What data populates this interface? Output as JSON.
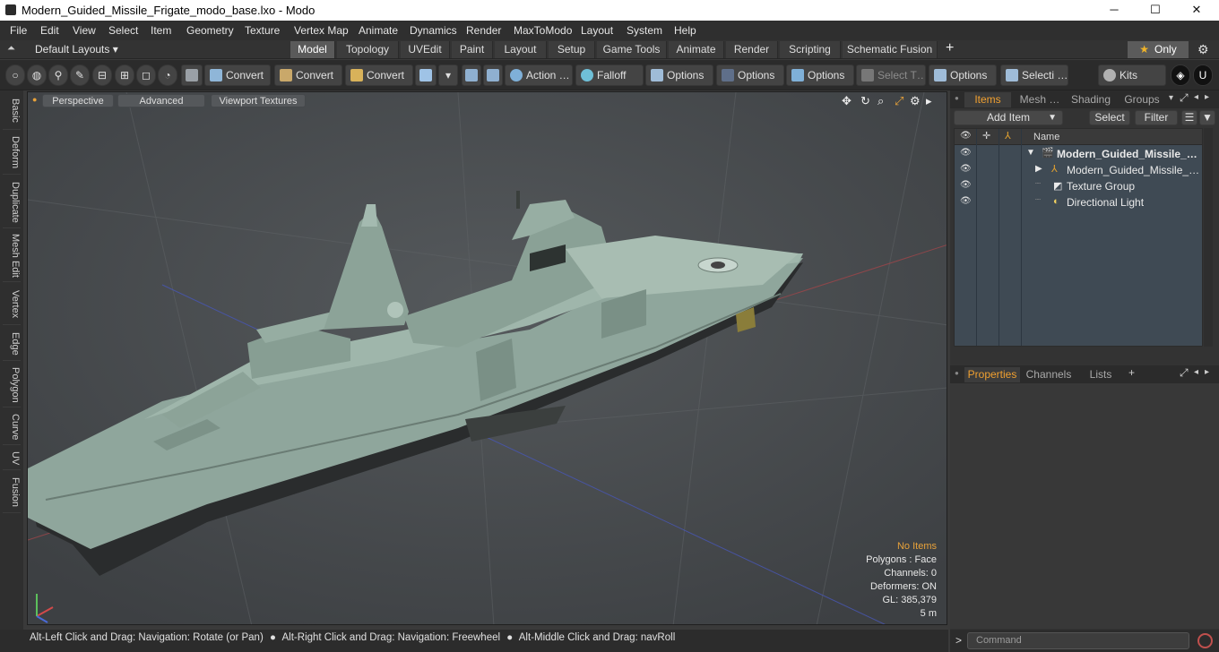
{
  "window": {
    "title": "Modern_Guided_Missile_Frigate_modo_base.lxo - Modo",
    "minimize": "─",
    "maximize": "☐",
    "close": "✕"
  },
  "menu": [
    "File",
    "Edit",
    "View",
    "Select",
    "Item",
    "Geometry",
    "Texture",
    "Vertex Map",
    "Animate",
    "Dynamics",
    "Render",
    "MaxToModo",
    "Layout",
    "System",
    "Help"
  ],
  "layout_bar": {
    "layouts_label": "Default Layouts ▾",
    "tabs": [
      "Model",
      "Topology",
      "UVEdit",
      "Paint",
      "Layout",
      "Setup",
      "Game Tools",
      "Animate",
      "Render",
      "Scripting",
      "Schematic Fusion"
    ],
    "active_tab": "Model",
    "plus": "+",
    "only_label": "Only",
    "star": "★",
    "gear": "⚙"
  },
  "toolbar": {
    "convert_1": "Convert",
    "convert_2": "Convert",
    "convert_3": "Convert",
    "action": "Action …",
    "falloff": "Falloff",
    "options_1": "Options",
    "options_2": "Options",
    "options_3": "Options",
    "select_t": "Select T…",
    "options_4": "Options",
    "selecti": "Selecti …",
    "kits": "Kits"
  },
  "left_tabs": [
    "Basic",
    "Deform",
    "Duplicate",
    "Mesh Edit",
    "Vertex",
    "Edge",
    "Polygon",
    "Curve",
    "UV",
    "Fusion"
  ],
  "viewport": {
    "perspective": "Perspective",
    "advanced": "Advanced",
    "viewport_textures": "Viewport Textures",
    "info": {
      "no_items": "No Items",
      "polygons": "Polygons : Face",
      "channels": "Channels: 0",
      "deformers": "Deformers: ON",
      "gl": "GL: 385,379",
      "scale": "5 m"
    }
  },
  "status": {
    "part1": "Alt-Left Click and Drag: Navigation: Rotate (or Pan)",
    "part2": "Alt-Right Click and Drag: Navigation: Freewheel",
    "part3": "Alt-Middle Click and Drag: navRoll",
    "dot": "●"
  },
  "items_panel": {
    "tabs": [
      "Items",
      "Mesh …",
      "Shading",
      "Groups"
    ],
    "active_tab": "Items",
    "add_item": "Add Item",
    "select": "Select",
    "filter": "Filter",
    "name_header": "Name",
    "rows": [
      {
        "label": "Modern_Guided_Missile_F…",
        "bold": true
      },
      {
        "label": "Modern_Guided_Missile_Frig…",
        "bold": false
      },
      {
        "label": "Texture Group",
        "bold": false
      },
      {
        "label": "Directional Light",
        "bold": false
      }
    ]
  },
  "properties_panel": {
    "tabs": [
      "Properties",
      "Channels",
      "Lists"
    ],
    "active_tab": "Properties",
    "plus": "+"
  },
  "command": {
    "placeholder": "Command",
    "prompt": ">"
  },
  "colors": {
    "accent": "#f0a030",
    "viewport_bg": "#4a4d50",
    "ship_hull": "#8fa69c"
  }
}
